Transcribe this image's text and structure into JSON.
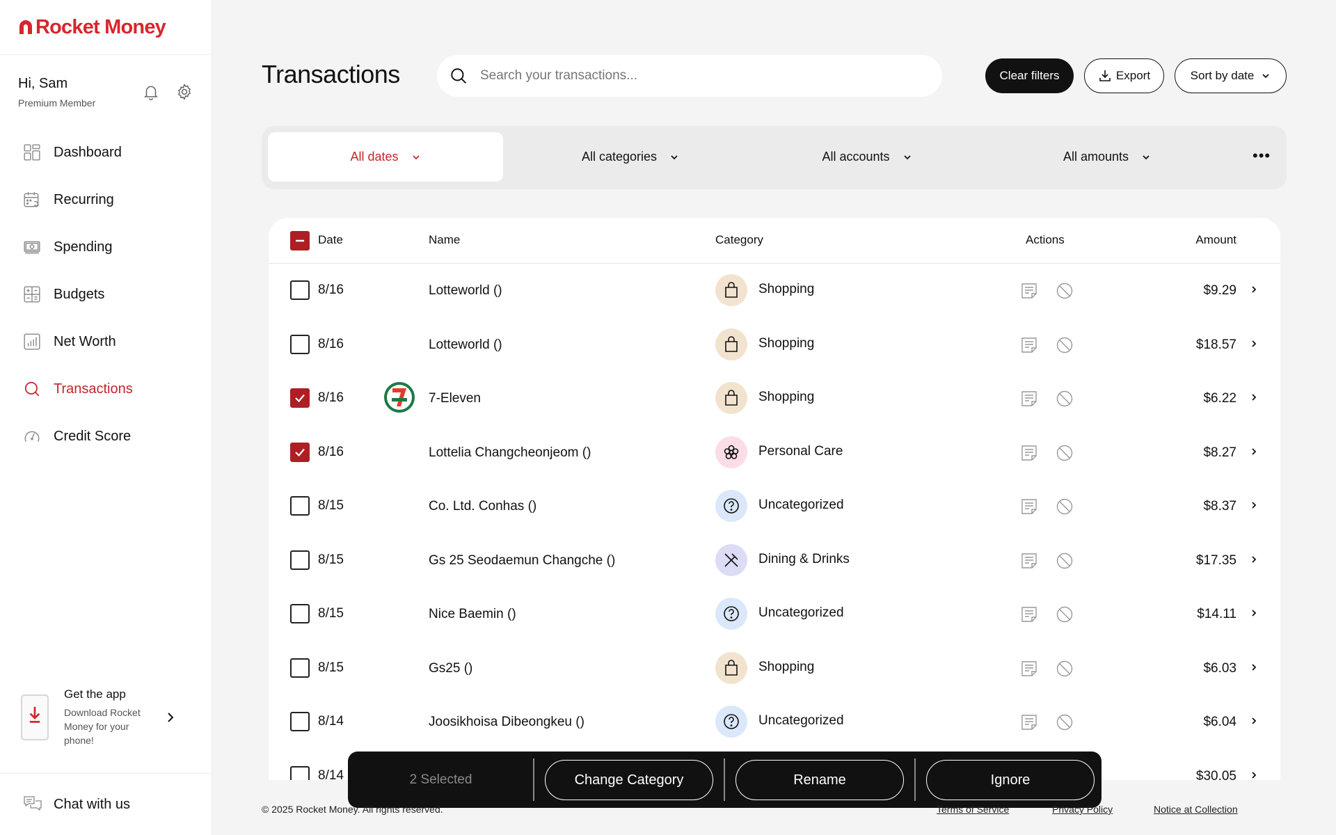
{
  "brand": {
    "name": "Rocket Money",
    "color": "#d7262b"
  },
  "user": {
    "greeting": "Hi, Sam",
    "tier": "Premium Member"
  },
  "nav": [
    {
      "label": "Dashboard",
      "icon": "dashboard-icon"
    },
    {
      "label": "Recurring",
      "icon": "recurring-calendar-icon"
    },
    {
      "label": "Spending",
      "icon": "spending-money-icon"
    },
    {
      "label": "Budgets",
      "icon": "budgets-calculator-icon"
    },
    {
      "label": "Net Worth",
      "icon": "net-worth-chart-icon"
    },
    {
      "label": "Transactions",
      "icon": "search-icon",
      "active": true
    },
    {
      "label": "Credit Score",
      "icon": "credit-score-gauge-icon"
    }
  ],
  "get_app": {
    "title": "Get the app",
    "description": "Download Rocket Money for your phone!"
  },
  "chat": {
    "label": "Chat with us"
  },
  "header": {
    "title": "Transactions",
    "search_placeholder": "Search your transactions...",
    "clear_filters": "Clear filters",
    "export": "Export",
    "sort": "Sort by date"
  },
  "filters": {
    "dates": "All dates",
    "categories": "All categories",
    "accounts": "All accounts",
    "amounts": "All amounts",
    "more": "•••"
  },
  "table": {
    "columns": {
      "date": "Date",
      "name": "Name",
      "category": "Category",
      "actions": "Actions",
      "amount": "Amount"
    },
    "rows": [
      {
        "date": "8/16",
        "name": "Lotteworld ()",
        "category": "Shopping",
        "amount": "$9.29",
        "checked": false
      },
      {
        "date": "8/16",
        "name": "Lotteworld ()",
        "category": "Shopping",
        "amount": "$18.57",
        "checked": false
      },
      {
        "date": "8/16",
        "name": "7-Eleven",
        "category": "Shopping",
        "amount": "$6.22",
        "checked": true,
        "logo": "7-eleven"
      },
      {
        "date": "8/16",
        "name": "Lottelia Changcheonjeom ()",
        "category": "Personal Care",
        "amount": "$8.27",
        "checked": true
      },
      {
        "date": "8/15",
        "name": "Co. Ltd. Conhas ()",
        "category": "Uncategorized",
        "amount": "$8.37",
        "checked": false
      },
      {
        "date": "8/15",
        "name": "Gs 25 Seodaemun Changche ()",
        "category": "Dining & Drinks",
        "amount": "$17.35",
        "checked": false
      },
      {
        "date": "8/15",
        "name": "Nice Baemin ()",
        "category": "Uncategorized",
        "amount": "$14.11",
        "checked": false
      },
      {
        "date": "8/15",
        "name": "Gs25 ()",
        "category": "Shopping",
        "amount": "$6.03",
        "checked": false
      },
      {
        "date": "8/14",
        "name": "Joosikhoisa Dibeongkeu ()",
        "category": "Uncategorized",
        "amount": "$6.04",
        "checked": false
      },
      {
        "date": "8/14",
        "name": "",
        "category": "",
        "amount": "$30.05",
        "checked": false
      }
    ]
  },
  "selection_bar": {
    "count": "2 Selected",
    "change_category": "Change Category",
    "rename": "Rename",
    "ignore": "Ignore"
  },
  "footer": {
    "copyright": "© 2025 Rocket Money. All rights reserved.",
    "terms": "Terms of Service",
    "privacy": "Privacy Policy",
    "notice": "Notice at Collection"
  },
  "category_colors": {
    "Shopping": "#f2e3cf",
    "Personal Care": "#fbdde6",
    "Uncategorized": "#dbe7fb",
    "Dining & Drinks": "#dcdcf7"
  }
}
